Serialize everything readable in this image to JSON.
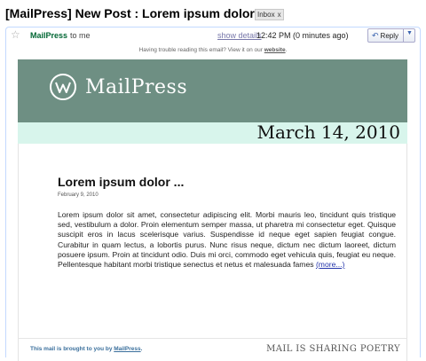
{
  "email": {
    "subject": "[MailPress] New Post : Lorem ipsum dolor ...",
    "label": "Inbox",
    "label_close": "x",
    "sender_name": "MailPress",
    "sender_to": "to me",
    "show_details": "show details",
    "time": "12:42 PM (0 minutes ago)",
    "reply_label": "Reply"
  },
  "notice": {
    "text": "Having trouble reading this email? View it on our",
    "link": "website",
    "end": "."
  },
  "newsletter": {
    "brand": "MailPress",
    "date": "March 14, 2010",
    "post_title": "Lorem ipsum dolor ...",
    "post_date": "February 9, 2010",
    "post_body": "Lorem ipsum dolor sit amet, consectetur adipiscing elit. Morbi mauris leo, tincidunt quis tristique sed, vestibulum a dolor. Proin elementum semper massa, ut pharetra mi consectetur eget. Quisque suscipit eros in lacus scelerisque varius. Suspendisse id neque eget sapien feugiat congue. Curabitur in quam lectus, a lobortis purus. Nunc risus neque, dictum nec dictum laoreet, dictum posuere ipsum. Proin at tincidunt odio. Duis mi orci, commodo eget vehicula quis, feugiat eu neque. Pellentesque habitant morbi tristique senectus et netus et malesuada fames",
    "more": "(more...)",
    "footer_prefix": "This mail is brought to you by",
    "footer_link": "MailPress",
    "footer_end": ".",
    "tagline": "MAIL IS SHARING POETRY"
  },
  "colors": {
    "banner": "#6e8f83",
    "date_band": "#d8f5ec",
    "sender": "#006633"
  }
}
